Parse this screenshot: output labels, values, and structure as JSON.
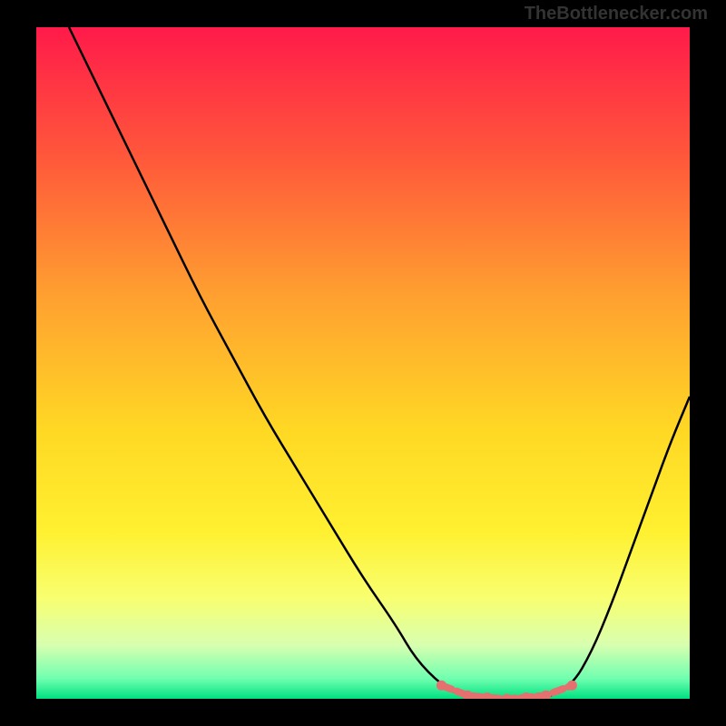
{
  "watermark": "TheBottlenecker.com",
  "chart_data": {
    "type": "line",
    "title": "",
    "xlabel": "",
    "ylabel": "",
    "xlim": [
      0,
      100
    ],
    "ylim": [
      0,
      100
    ],
    "background_gradient": {
      "stops": [
        {
          "offset": 0,
          "color": "#ff1a4a"
        },
        {
          "offset": 20,
          "color": "#ff5a3a"
        },
        {
          "offset": 40,
          "color": "#ffa030"
        },
        {
          "offset": 60,
          "color": "#ffd824"
        },
        {
          "offset": 75,
          "color": "#fff030"
        },
        {
          "offset": 85,
          "color": "#f8ff70"
        },
        {
          "offset": 92,
          "color": "#d8ffb0"
        },
        {
          "offset": 97,
          "color": "#70ffb0"
        },
        {
          "offset": 100,
          "color": "#00e080"
        }
      ]
    },
    "curve": [
      {
        "x": 5,
        "y": 100
      },
      {
        "x": 10,
        "y": 90
      },
      {
        "x": 15,
        "y": 80
      },
      {
        "x": 20,
        "y": 70
      },
      {
        "x": 25,
        "y": 60
      },
      {
        "x": 30,
        "y": 51
      },
      {
        "x": 35,
        "y": 42
      },
      {
        "x": 40,
        "y": 34
      },
      {
        "x": 45,
        "y": 26
      },
      {
        "x": 50,
        "y": 18
      },
      {
        "x": 55,
        "y": 11
      },
      {
        "x": 58,
        "y": 6
      },
      {
        "x": 62,
        "y": 2
      },
      {
        "x": 66,
        "y": 0
      },
      {
        "x": 72,
        "y": 0
      },
      {
        "x": 78,
        "y": 0
      },
      {
        "x": 82,
        "y": 2
      },
      {
        "x": 85,
        "y": 7
      },
      {
        "x": 88,
        "y": 14
      },
      {
        "x": 91,
        "y": 22
      },
      {
        "x": 94,
        "y": 30
      },
      {
        "x": 97,
        "y": 38
      },
      {
        "x": 100,
        "y": 45
      }
    ],
    "markers": [
      {
        "x": 62,
        "y": 2
      },
      {
        "x": 66,
        "y": 0.5
      },
      {
        "x": 69,
        "y": 0.2
      },
      {
        "x": 72,
        "y": 0
      },
      {
        "x": 75,
        "y": 0.2
      },
      {
        "x": 78,
        "y": 0.5
      },
      {
        "x": 82,
        "y": 2
      }
    ],
    "marker_color": "#e57070"
  }
}
